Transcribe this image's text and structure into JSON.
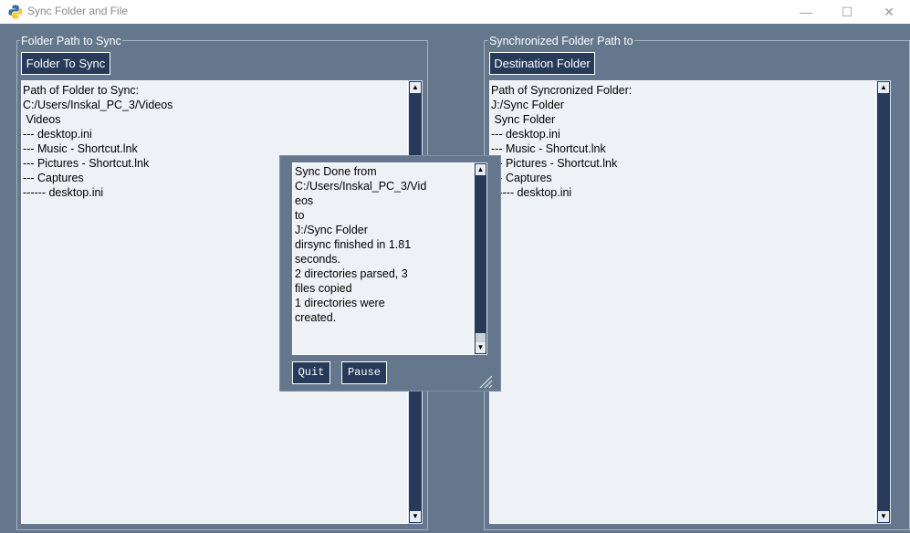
{
  "window": {
    "title": "Sync Folder and File"
  },
  "left_panel": {
    "frame_label": "Folder Path to Sync",
    "button_label": "Folder To Sync",
    "lines": [
      "Path of Folder to Sync:",
      "C:/Users/Inskal_PC_3/Videos",
      "",
      " Videos",
      "--- desktop.ini",
      "--- Music - Shortcut.lnk",
      "--- Pictures - Shortcut.lnk",
      "--- Captures",
      "------ desktop.ini"
    ]
  },
  "right_panel": {
    "frame_label": "Synchronized Folder Path to",
    "button_label": "Destination Folder",
    "lines": [
      "Path of Syncronized Folder:",
      "J:/Sync Folder",
      "",
      " Sync Folder",
      "--- desktop.ini",
      "--- Music - Shortcut.lnk",
      "--- Pictures - Shortcut.lnk",
      "--- Captures",
      "------ desktop.ini"
    ]
  },
  "popup": {
    "lines": [
      "Sync Done from",
      "C:/Users/Inskal_PC_3/Vid",
      "eos",
      "to",
      "J:/Sync Folder",
      "",
      "dirsync finished in 1.81",
      "seconds.",
      "2 directories parsed, 3",
      "files copied",
      "1 directories were",
      "created."
    ],
    "quit_label": "Quit",
    "pause_label": "Pause"
  },
  "colors": {
    "background": "#64778d",
    "button": "#283a5a",
    "text_area": "#eef1f6"
  }
}
